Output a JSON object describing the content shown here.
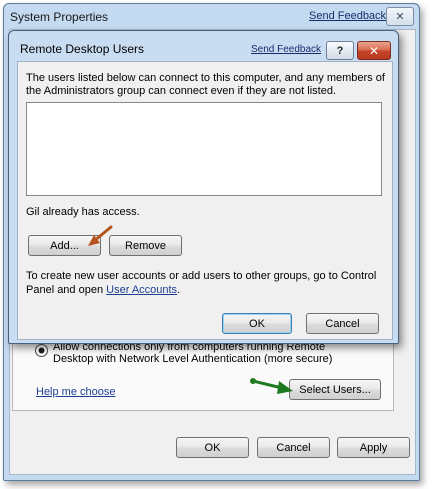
{
  "outer_window": {
    "title": "System Properties",
    "feedback_link": "Send Feedback",
    "close_glyph": "✕",
    "radio_option_line1": "Allow connections only from computers running Remote",
    "radio_option_line2": "Desktop with Network Level Authentication (more secure)",
    "help_link": "Help me choose",
    "select_users_button": "Select Users...",
    "ok_button": "OK",
    "cancel_button": "Cancel",
    "apply_button": "Apply"
  },
  "dialog": {
    "title": "Remote Desktop Users",
    "feedback_link": "Send Feedback",
    "help_glyph": "?",
    "close_glyph": "✕",
    "description": "The users listed below can connect to this computer, and any members of the Administrators group can connect even if they are not listed.",
    "users": [],
    "access_text": "Gil already has access.",
    "add_button": "Add...",
    "remove_button": "Remove",
    "hint_text": "To create new user accounts or add users to other groups, go to Control Panel and open ",
    "hint_link": "User Accounts",
    "hint_end": ".",
    "ok_button": "OK",
    "cancel_button": "Cancel"
  },
  "annotations": {
    "add_arrow_color": "#b5541c",
    "select_users_arrow_color": "#1f7a1f"
  }
}
